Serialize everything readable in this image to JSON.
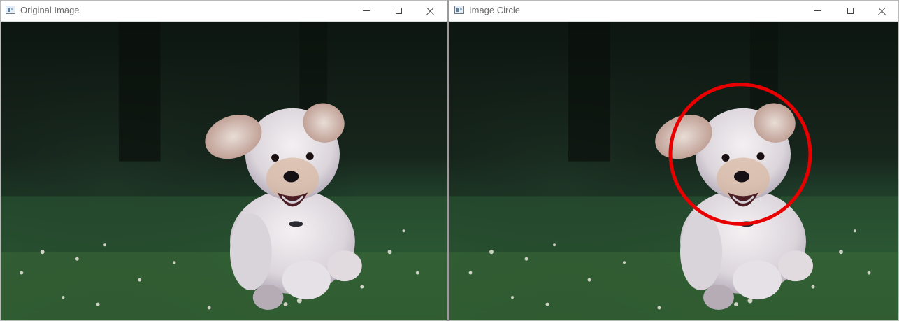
{
  "windows": [
    {
      "title": "Original Image"
    },
    {
      "title": "Image Circle"
    }
  ],
  "controls": {
    "minimize_icon": "minimize-icon",
    "maximize_icon": "maximize-icon",
    "close_icon": "close-icon"
  },
  "scene": {
    "subject": "dog-running-on-grass",
    "annotation_color": "#e80000"
  }
}
